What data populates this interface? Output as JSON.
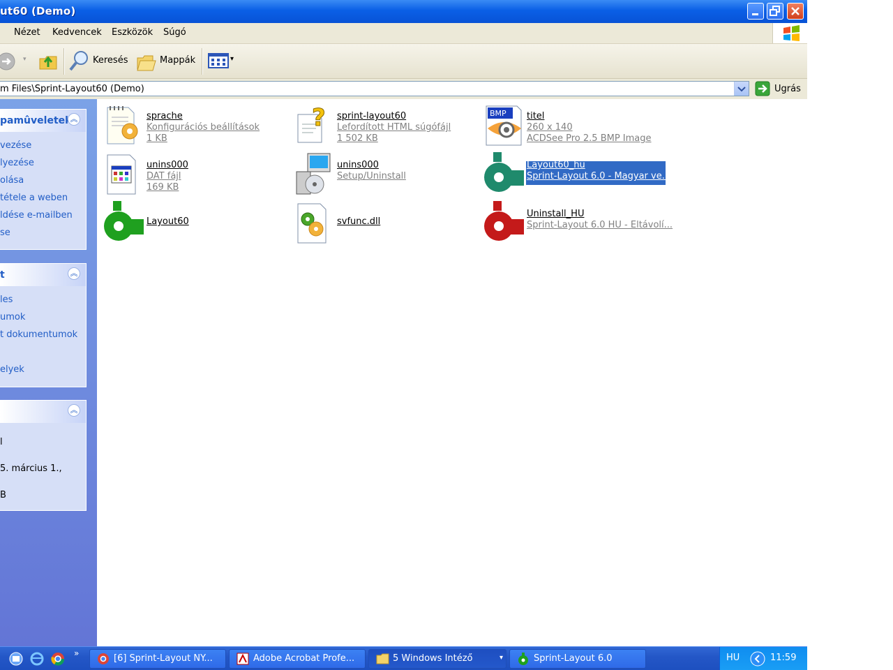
{
  "window": {
    "title": "ut60 (Demo)"
  },
  "menu": [
    "Nézet",
    "Kedvencek",
    "Eszközök",
    "Súgó"
  ],
  "toolbar": {
    "search_label": "Keresés",
    "folders_label": "Mappák"
  },
  "address": {
    "value": "m Files\\Sprint-Layout60 (Demo)",
    "go_label": "Ugrás"
  },
  "sidebar": {
    "panel1": {
      "title": "pamûveletek",
      "links": [
        "vezése",
        "lyezése",
        "olása",
        "tétele a weben",
        "ldése e-mailben",
        "se"
      ]
    },
    "panel2": {
      "title": "t",
      "links": [
        "les",
        "umok",
        "t dokumentumok",
        "elyek"
      ]
    },
    "panel3": {
      "lines": [
        "l",
        "5. március 1.,",
        "B"
      ]
    }
  },
  "files": [
    {
      "name": "sprache",
      "line2": "Konfigurációs beállítások",
      "line3": "1 KB",
      "icon": "config-file-icon"
    },
    {
      "name": "sprint-layout60",
      "line2": "Lefordított HTML súgófájl",
      "line3": "1 502 KB",
      "icon": "help-file-icon"
    },
    {
      "name": "titel",
      "line2": "260 x 140",
      "line3": "ACDSee Pro 2.5 BMP Image",
      "icon": "bmp-image-icon",
      "badge": "BMP"
    },
    {
      "name": "unins000",
      "line2": "DAT fájl",
      "line3": "169 KB",
      "icon": "dat-file-icon"
    },
    {
      "name": "unins000",
      "line2": "Setup/Uninstall",
      "line3": "",
      "icon": "setup-icon"
    },
    {
      "name": "Layout60_hu",
      "line2": "Sprint-Layout 6.0 - Magyar ve...",
      "line3": "",
      "icon": "teal-pipe-icon",
      "selected": true
    },
    {
      "name": "Layout60",
      "line2": "",
      "line3": "",
      "icon": "green-pipe-icon"
    },
    {
      "name": "svfunc.dll",
      "line2": "",
      "line3": "",
      "icon": "dll-file-icon"
    },
    {
      "name": "Uninstall_HU",
      "line2": "Sprint-Layout 6.0 HU - Eltávolí...",
      "line3": "",
      "icon": "red-pipe-icon"
    }
  ],
  "taskbar": {
    "buttons": [
      {
        "label": "[6] Sprint-Layout NY...",
        "icon": "chrome-icon"
      },
      {
        "label": "Adobe Acrobat Profe...",
        "icon": "acrobat-icon"
      },
      {
        "label": "5 Windows Intéző",
        "icon": "folder-icon"
      },
      {
        "label": "Sprint-Layout 6.0",
        "icon": "sprint-layout-icon"
      }
    ],
    "language": "HU",
    "clock": "11:59"
  },
  "colors": {
    "titlebar": "#0a5fe6",
    "sidebar": "#6d8ee0",
    "selection": "#316ac5",
    "taskbar": "#245dda"
  }
}
